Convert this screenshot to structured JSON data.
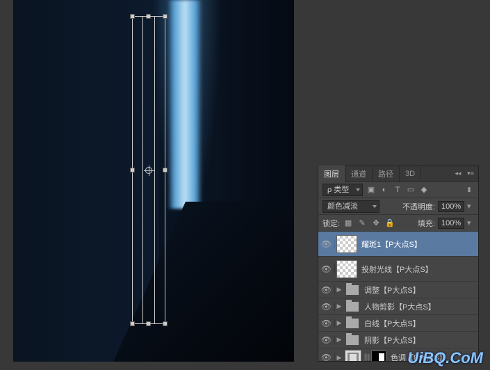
{
  "canvas": {
    "transform_active": true
  },
  "panel": {
    "tabs": [
      "图层",
      "通道",
      "路径",
      "3D"
    ],
    "active_tab": 0,
    "kind_label": "类型",
    "kind_icon": "ρ",
    "filter_icons": [
      "image-icon",
      "adjust-icon",
      "type-icon",
      "shape-icon",
      "smart-icon"
    ],
    "filter_glyphs": [
      "▣",
      "◐",
      "T",
      "▭",
      "◆"
    ],
    "blend_mode": "颜色减淡",
    "opacity_label": "不透明度:",
    "opacity_value": "100%",
    "lock_label": "锁定:",
    "lock_icons": [
      "lock-transparent",
      "lock-image",
      "lock-position",
      "lock-all"
    ],
    "lock_glyphs": [
      "▦",
      "✎",
      "✥",
      "🔒"
    ],
    "fill_label": "填充:",
    "fill_value": "100%"
  },
  "layers": [
    {
      "visible": true,
      "type": "layer",
      "thumb": "checker",
      "name": "耀斑1【P大点S】",
      "selected": true,
      "tall": true
    },
    {
      "visible": true,
      "type": "layer",
      "thumb": "checker",
      "name": "投射光线【P大点S】",
      "tall": true
    },
    {
      "visible": true,
      "type": "group",
      "name": "调整【P大点S】"
    },
    {
      "visible": true,
      "type": "group",
      "name": "人物剪影【P大点S】"
    },
    {
      "visible": true,
      "type": "group",
      "name": "白线【P大点S】"
    },
    {
      "visible": true,
      "type": "group",
      "name": "阴影【P大点S】"
    },
    {
      "visible": true,
      "type": "adjust",
      "thumb": "mask",
      "name": "色调【P大点S】"
    }
  ],
  "watermark": "UiBQ.CoM"
}
